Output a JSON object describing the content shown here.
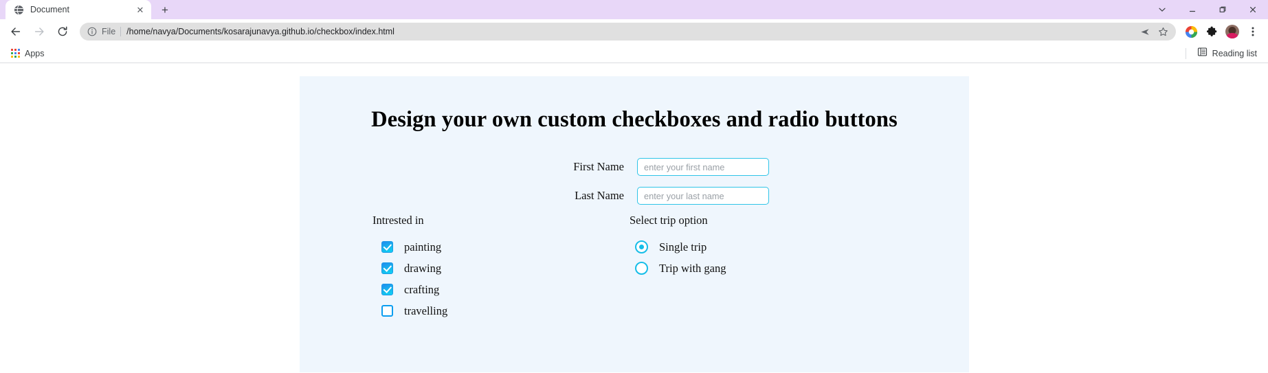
{
  "browser": {
    "tab": {
      "title": "Document",
      "favicon": "globe-icon",
      "close_label": "✕"
    },
    "new_tab_label": "+",
    "window_controls": {
      "chevron": "⌄",
      "minimize": "–",
      "maximize": "❐",
      "close": "✕"
    },
    "toolbar": {
      "back": "←",
      "forward": "→",
      "reload": "⟳",
      "file_label": "File",
      "url": "/home/navya/Documents/kosarajunavya.github.io/checkbox/index.html",
      "share_icon": "send-icon",
      "bookmark_icon": "star-icon",
      "profile_icon": "color-wheel-icon",
      "extensions_icon": "puzzle-icon",
      "avatar_icon": "avatar",
      "menu_icon": "⋮"
    },
    "bookmarks": {
      "apps_label": "Apps",
      "reading_list_label": "Reading list"
    }
  },
  "page": {
    "heading": "Design your own custom checkboxes and radio buttons",
    "fields": [
      {
        "label": "First Name",
        "value": "",
        "placeholder": "enter your first name"
      },
      {
        "label": "Last Name",
        "value": "",
        "placeholder": "enter your last name"
      }
    ],
    "checkbox_group": {
      "title": "Intrested in",
      "options": [
        {
          "label": "painting",
          "checked": true
        },
        {
          "label": "drawing",
          "checked": true
        },
        {
          "label": "crafting",
          "checked": true
        },
        {
          "label": "travelling",
          "checked": false
        }
      ]
    },
    "radio_group": {
      "title": "Select trip option",
      "options": [
        {
          "label": "Single trip",
          "selected": true
        },
        {
          "label": "Trip with gang",
          "selected": false
        }
      ]
    },
    "colors": {
      "panel_background": "#eff6fd",
      "accent_cyan": "#15bde8",
      "checkbox_blue": "#0b9df0",
      "input_border": "#2ec4e8"
    }
  }
}
